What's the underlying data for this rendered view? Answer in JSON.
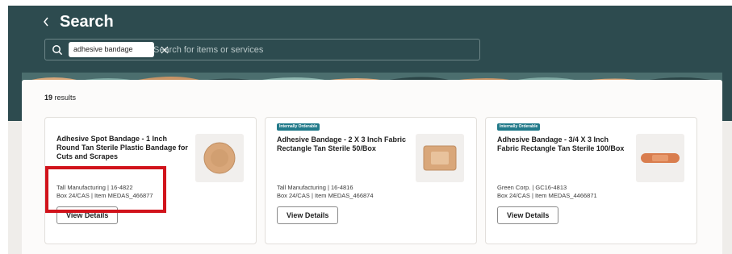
{
  "header": {
    "title": "Search",
    "back_icon": "chevron-left-icon"
  },
  "search": {
    "chip_label": "adhesive bandage",
    "placeholder": "Search for items or services"
  },
  "results": {
    "count": "19",
    "label": " results"
  },
  "cards": [
    {
      "badge": "",
      "title": "Adhesive Spot Bandage - 1 Inch Round Tan Sterile Plastic Bandage for Cuts and Scrapes",
      "line1": "Tall Manufacturing | 16-4822",
      "line2": "Box 24/CAS | Item MEDAS_466877",
      "button": "View Details",
      "image": "round-bandage-image"
    },
    {
      "badge": "Internally Orderable",
      "title": "Adhesive Bandage - 2 X 3 Inch Fabric Rectangle Tan Sterile 50/Box",
      "line1": "Tall Manufacturing | 16-4816",
      "line2": "Box 24/CAS | Item MEDAS_466874",
      "button": "View Details",
      "image": "rectangle-bandage-image"
    },
    {
      "badge": "Internally Orderable",
      "title": "Adhesive Bandage - 3/4 X 3 Inch Fabric Rectangle Tan Sterile 100/Box",
      "line1": "Green Corp. | GC16-4813",
      "line2": "Box 24/CAS | Item MEDAS_4466871",
      "button": "View Details",
      "image": "strip-bandage-image"
    }
  ],
  "colors": {
    "header_bg": "#2d4b4f",
    "badge_bg": "#227a8a",
    "highlight": "#d1131b",
    "bandage": "#d9a77a"
  }
}
